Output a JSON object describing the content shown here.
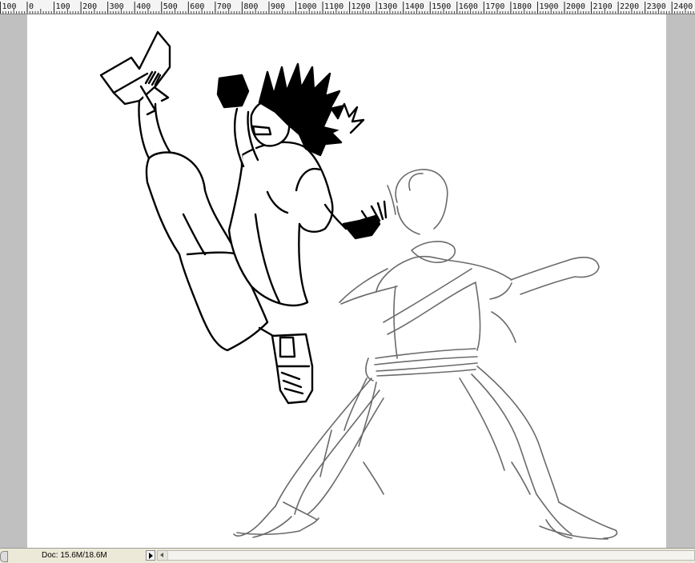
{
  "ruler": {
    "labels": [
      "100",
      "0",
      "100",
      "200",
      "300",
      "400",
      "500",
      "600",
      "700",
      "800",
      "900",
      "1000",
      "1100",
      "1200",
      "1300",
      "1400",
      "1500",
      "1600",
      "1700",
      "1800",
      "1900",
      "2000",
      "2100",
      "2200",
      "2300",
      "2400"
    ]
  },
  "status": {
    "doc_info": "Doc: 15.6M/18.6M"
  },
  "icons": {
    "status_menu": "play-arrow-icon",
    "scroll_left": "scroll-left-arrow-icon"
  },
  "colors": {
    "workspace": "#c0c0c0",
    "canvas": "#ffffff",
    "ruler": "#f4f4f4",
    "status_bar": "#ece9d8",
    "sketch_pencil": "#555555",
    "ink": "#000000"
  }
}
